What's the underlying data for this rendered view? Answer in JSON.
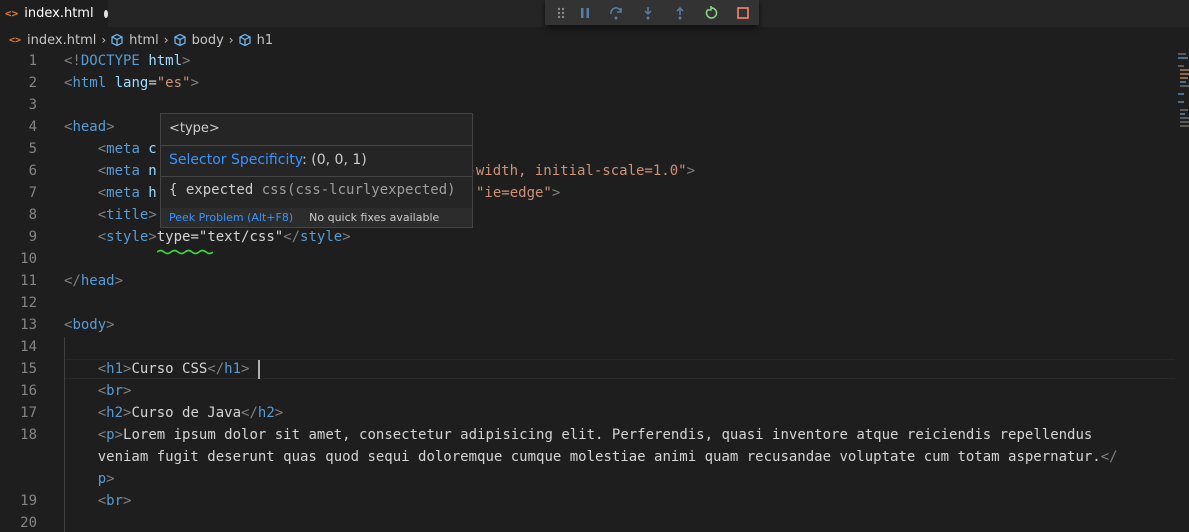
{
  "tab": {
    "title": "index.html",
    "icon": "html-file-icon",
    "dirty": true
  },
  "debug_toolbar": {
    "buttons": [
      "drag-handle-icon",
      "pause-icon",
      "step-over-icon",
      "step-into-icon",
      "step-out-icon",
      "restart-icon",
      "stop-icon"
    ]
  },
  "breadcrumb": {
    "file": "index.html",
    "items": [
      "html",
      "body",
      "h1"
    ]
  },
  "line_numbers": [
    "1",
    "2",
    "3",
    "4",
    "5",
    "6",
    "7",
    "8",
    "9",
    "10",
    "11",
    "12",
    "13",
    "14",
    "15",
    "16",
    "17",
    "18",
    "19",
    "20"
  ],
  "code": {
    "l1": {
      "lt": "<!",
      "kw": "DOCTYPE",
      "sp": " ",
      "name": "html",
      "gt": ">"
    },
    "l2": {
      "lt": "<",
      "tag": "html",
      "sp": " ",
      "attr": "lang",
      "eq": "=",
      "val": "\"es\"",
      "gt": ">"
    },
    "l4": {
      "lt": "<",
      "tag": "head",
      "gt": ">"
    },
    "l5": {
      "indent": "    ",
      "lt": "<",
      "tag": "meta",
      "rest": " c"
    },
    "l6": {
      "indent": "    ",
      "lt": "<",
      "tag": "meta",
      "rest": " n",
      "tail": "e-width, initial-scale=1.0\"",
      "gt": ">"
    },
    "l7": {
      "indent": "    ",
      "lt": "<",
      "tag": "meta",
      "rest": " h",
      "tail": "\"ie=edge\"",
      "gt": ">"
    },
    "l8": {
      "indent": "    ",
      "lt": "<",
      "tag": "title",
      "gt": ">"
    },
    "l9": {
      "indent": "    ",
      "lt": "<",
      "tag": "style",
      "gt": ">",
      "text": "type=\"text/css\"",
      "lt2": "</",
      "tag2": "style",
      "gt2": ">"
    },
    "l11": {
      "lt": "</",
      "tag": "head",
      "gt": ">"
    },
    "l13": {
      "lt": "<",
      "tag": "body",
      "gt": ">"
    },
    "l15": {
      "indent": "    ",
      "lt": "<",
      "tag": "h1",
      "gt": ">",
      "text": "Curso CSS",
      "lt2": "</",
      "tag2": "h1",
      "gt2": ">"
    },
    "l16": {
      "indent": "    ",
      "lt": "<",
      "tag": "br",
      "gt": ">"
    },
    "l17": {
      "indent": "    ",
      "lt": "<",
      "tag": "h2",
      "gt": ">",
      "text": "Curso de Java",
      "lt2": "</",
      "tag2": "h2",
      "gt2": ">"
    },
    "l18a": {
      "indent": "    ",
      "lt": "<",
      "tag": "p",
      "gt": ">",
      "text": "Lorem ipsum dolor sit amet, consectetur adipisicing elit. Perferendis, quasi inventore atque reiciendis repellendus"
    },
    "l18b": {
      "indent": "    ",
      "text": "veniam fugit deserunt quas quod sequi doloremque cumque molestiae animi quam recusandae voluptate cum totam aspernatur.",
      "lt2": "</"
    },
    "l18c": {
      "indent": "    ",
      "tag2": "p",
      "gt2": ">"
    },
    "l19": {
      "indent": "    ",
      "lt": "<",
      "tag": "br",
      "gt": ">"
    }
  },
  "hover": {
    "title": "<type>",
    "specificity_label": "Selector Specificity",
    "specificity_value": ": (0, 0, 1)",
    "error_message": "{ expected",
    "error_source": " css(css-lcurlyexpected)",
    "peek_label": "Peek Problem (Alt+F8)",
    "no_fix_label": "No quick fixes available"
  },
  "colors": {
    "squiggle": "#3fd63f",
    "accent_link": "#3794ff",
    "html_icon": "#e37933"
  }
}
